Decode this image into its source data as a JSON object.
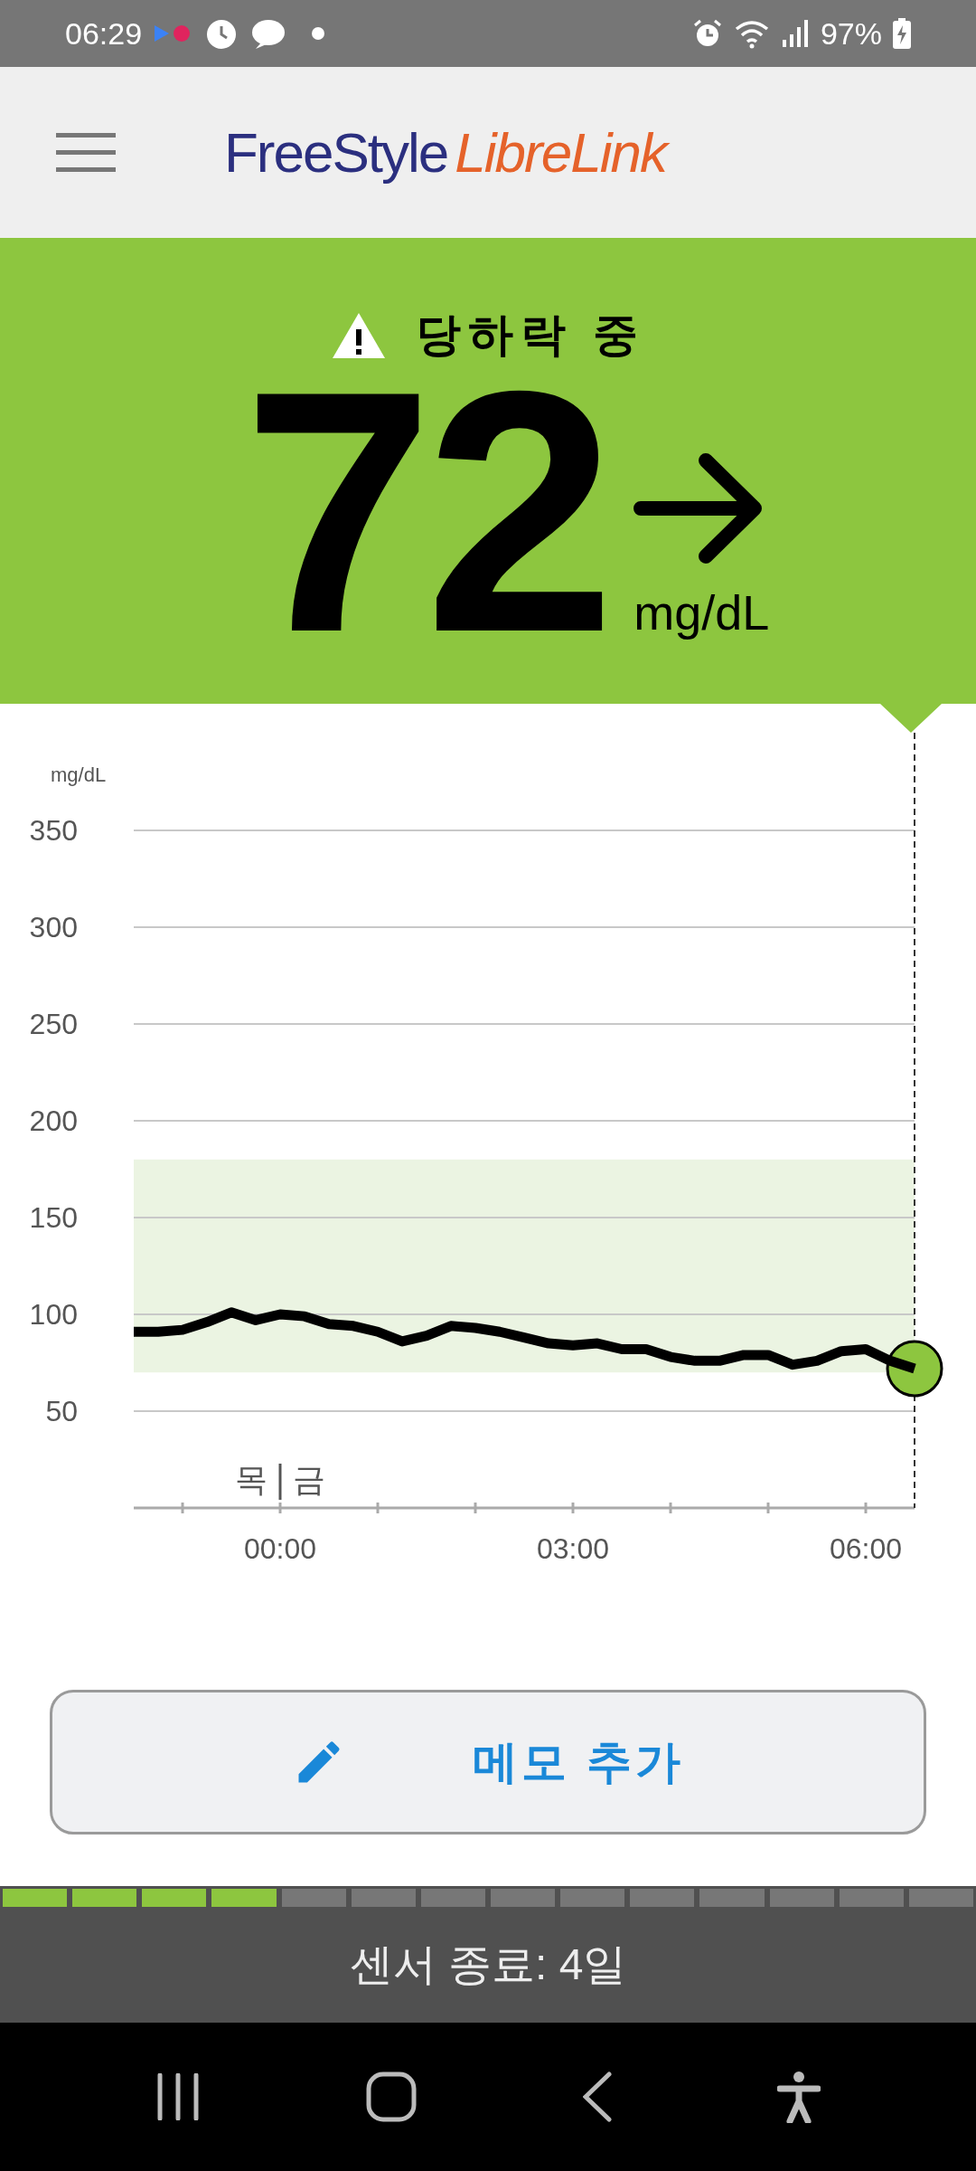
{
  "status_bar": {
    "time": "06:29",
    "battery": "97%"
  },
  "header": {
    "logo_left": "FreeStyle",
    "logo_right": "LibreLink"
  },
  "reading": {
    "alert": "당하락 중",
    "value": "72",
    "unit": "mg/dL"
  },
  "chart": {
    "day_labels": [
      "목",
      "금"
    ],
    "chart_data": {
      "type": "line",
      "ylabel": "mg/dL",
      "x": [
        -1.5,
        -1.25,
        -1,
        -0.75,
        -0.5,
        -0.25,
        0,
        0.25,
        0.5,
        0.75,
        1,
        1.25,
        1.5,
        1.75,
        2,
        2.25,
        2.5,
        2.75,
        3,
        3.25,
        3.5,
        3.75,
        4,
        4.25,
        4.5,
        4.75,
        5,
        5.25,
        5.5,
        5.75,
        6,
        6.25,
        6.5
      ],
      "series": [
        {
          "color": "#000000",
          "values": [
            91,
            91,
            92,
            96,
            101,
            97,
            100,
            99,
            95,
            94,
            91,
            86,
            89,
            94,
            93,
            91,
            88,
            85,
            84,
            85,
            82,
            82,
            78,
            76,
            76,
            79,
            79,
            74,
            76,
            81,
            82,
            76,
            72
          ]
        }
      ],
      "xlim": [
        -1.5,
        6.5
      ],
      "ylim": [
        0,
        350
      ],
      "grid": true,
      "xticks": [
        {
          "value": 0,
          "label": "00:00"
        },
        {
          "value": 3,
          "label": "03:00"
        },
        {
          "value": 6,
          "label": "06:00"
        }
      ],
      "yticks": [
        50,
        100,
        150,
        200,
        250,
        300,
        350
      ],
      "bands": [
        {
          "axis": "y",
          "from": 70,
          "to": 180,
          "color": "#ebf4e2"
        }
      ]
    }
  },
  "memo_button": {
    "label": "메모 추가"
  },
  "sensor": {
    "level": 0.2857,
    "label": "센서 종료: 4일"
  }
}
